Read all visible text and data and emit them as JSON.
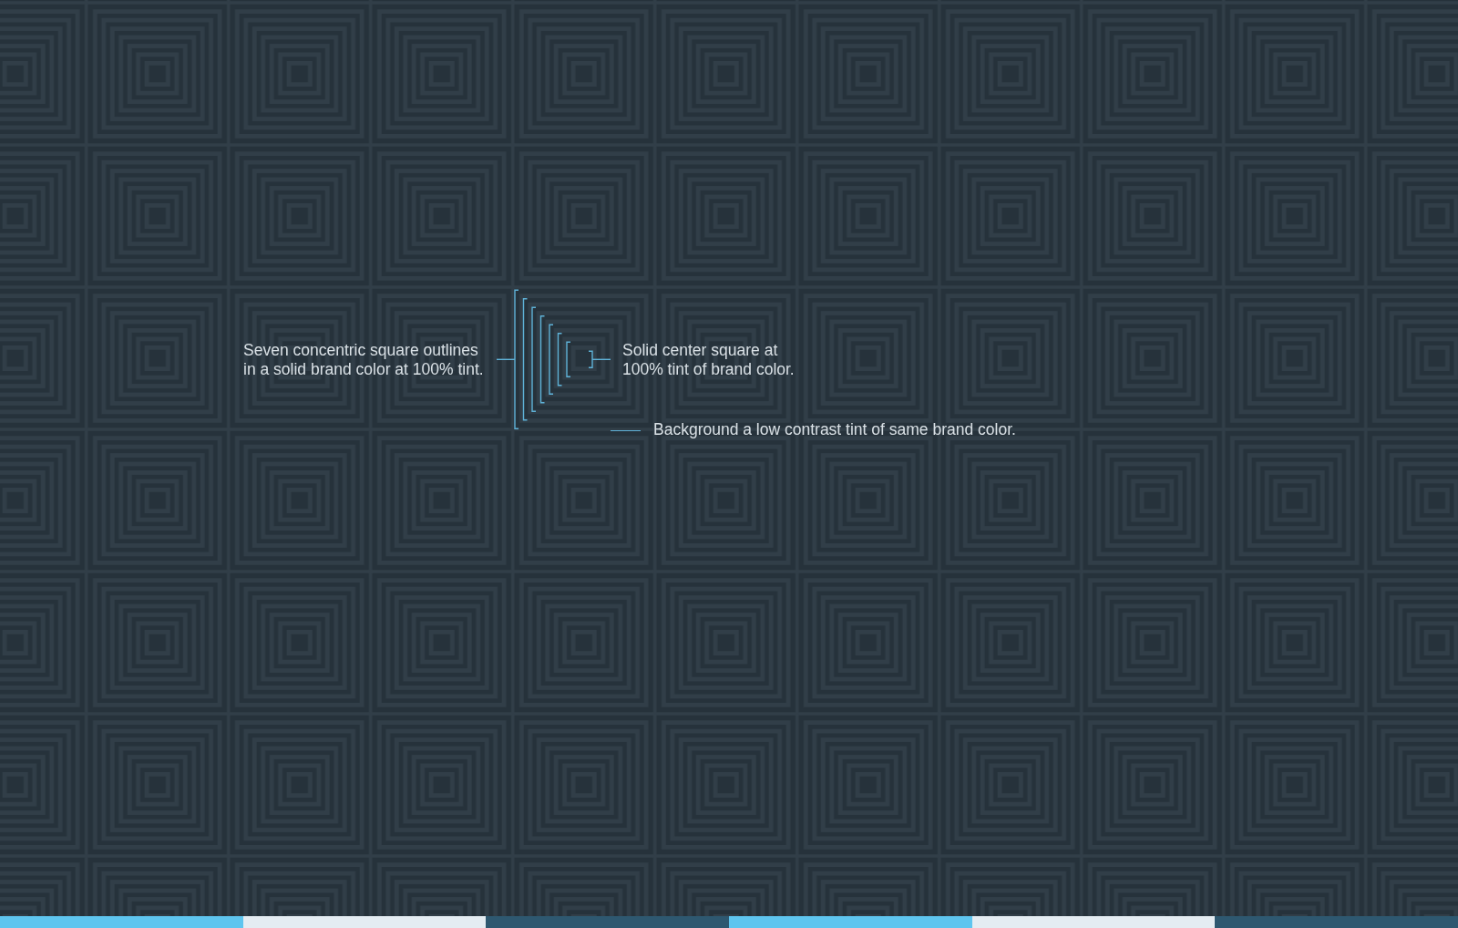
{
  "annotations": {
    "outlines": [
      "Seven concentric square outlines",
      "in a solid brand color at 100% tint."
    ],
    "center": [
      "Solid center square at",
      "100% tint of brand color."
    ],
    "background": [
      "Background a low contrast tint of same brand color."
    ]
  },
  "color_bar": [
    {
      "color": "#5ec5ef"
    },
    {
      "color": "#e4ecf2"
    },
    {
      "color": "#2e5870"
    },
    {
      "color": "#5ec5ef"
    },
    {
      "color": "#e4ecf2"
    },
    {
      "color": "#2e5870"
    }
  ]
}
